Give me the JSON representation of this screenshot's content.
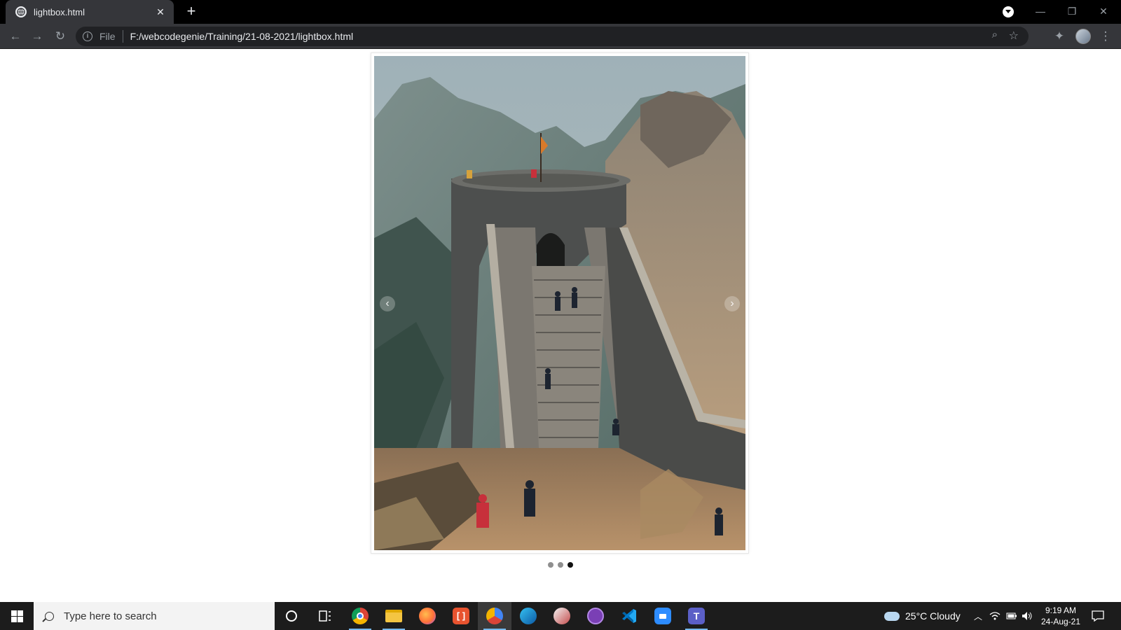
{
  "browser": {
    "tab": {
      "title": "lightbox.html",
      "close_glyph": "✕"
    },
    "new_tab_glyph": "+",
    "window": {
      "minimize": "—",
      "restore": "❐",
      "close": "✕"
    },
    "toolbar": {
      "back": "←",
      "forward": "→",
      "reload": "↻",
      "scheme": "File",
      "url": "F:/webcodegenie/Training/21-08-2021/lightbox.html",
      "zoom_glyph": "⌕",
      "star_glyph": "☆",
      "extensions_glyph": "✦",
      "menu_glyph": "⋮"
    }
  },
  "page": {
    "slideshow": {
      "prev_glyph": "‹",
      "next_glyph": "›",
      "slide_count": 3,
      "active_index": 3
    }
  },
  "taskbar": {
    "search_placeholder": "Type here to search",
    "apps": [
      "cortana-icon",
      "task-view-icon",
      "chrome-icon",
      "file-explorer-icon",
      "firefox-icon",
      "brackets-icon",
      "chrome-alt-icon",
      "edge-icon",
      "teams-alt-icon",
      "github-desktop-icon",
      "vscode-icon",
      "zoom-icon",
      "teams-icon"
    ],
    "weather": "25°C  Cloudy",
    "time": "9:19 AM",
    "date": "24-Aug-21"
  }
}
